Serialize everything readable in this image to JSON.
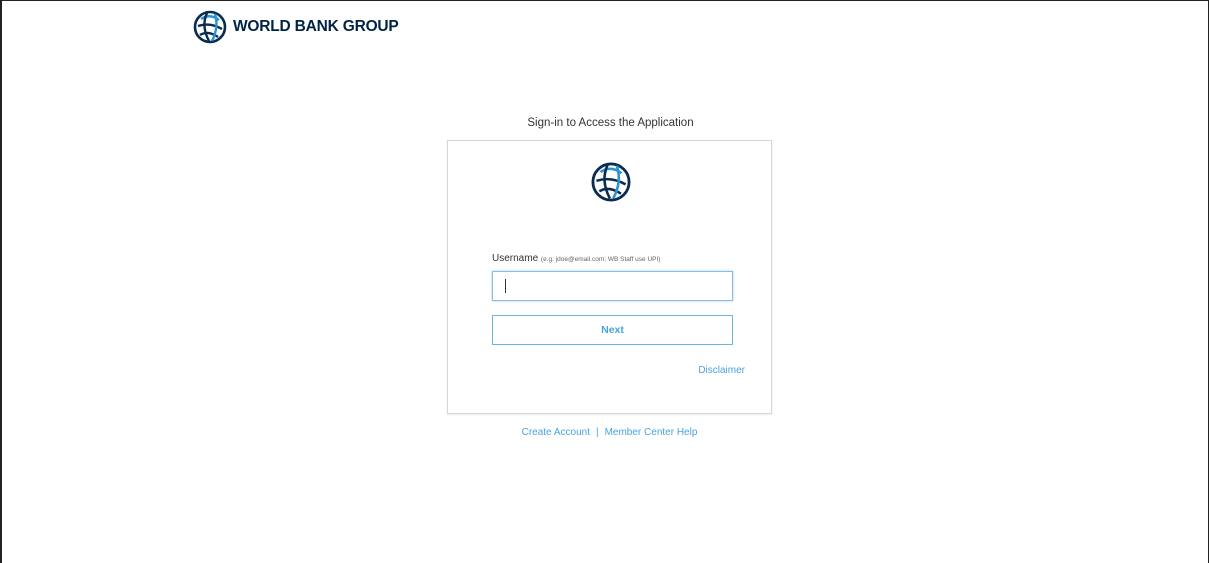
{
  "header": {
    "logo_text": "WORLD BANK GROUP",
    "logo_icon": "globe-icon",
    "brand_color": "#002244"
  },
  "signin": {
    "title": "Sign-in to Access the Application",
    "username_label": "Username",
    "username_hint": "(e.g. jdoe@email.com; WB Staff use UPI)",
    "username_value": "",
    "username_placeholder": "",
    "next_label": "Next",
    "disclaimer_label": "Disclaimer"
  },
  "footer": {
    "create_account_label": "Create Account",
    "separator": "|",
    "member_help_label": "Member Center Help"
  },
  "colors": {
    "link": "#4aa3df",
    "input_focus_border": "#87bde6"
  }
}
